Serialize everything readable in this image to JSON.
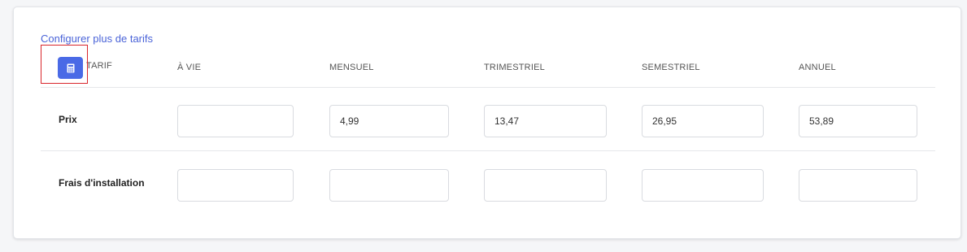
{
  "link": {
    "configure_more": "Configurer plus de tarifs"
  },
  "header": {
    "tarif": "TARIF",
    "columns": [
      "À VIE",
      "MENSUEL",
      "TRIMESTRIEL",
      "SEMESTRIEL",
      "ANNUEL"
    ]
  },
  "rows": [
    {
      "label": "Prix",
      "values": [
        "",
        "4,99",
        "13,47",
        "26,95",
        "53,89"
      ]
    },
    {
      "label": "Frais d'installation",
      "values": [
        "",
        "",
        "",
        "",
        ""
      ]
    }
  ],
  "colors": {
    "accent": "#4a6ae6",
    "link": "#4a63d8",
    "highlight": "#d9262c"
  },
  "icons": {
    "calculator": "calculator-icon"
  }
}
